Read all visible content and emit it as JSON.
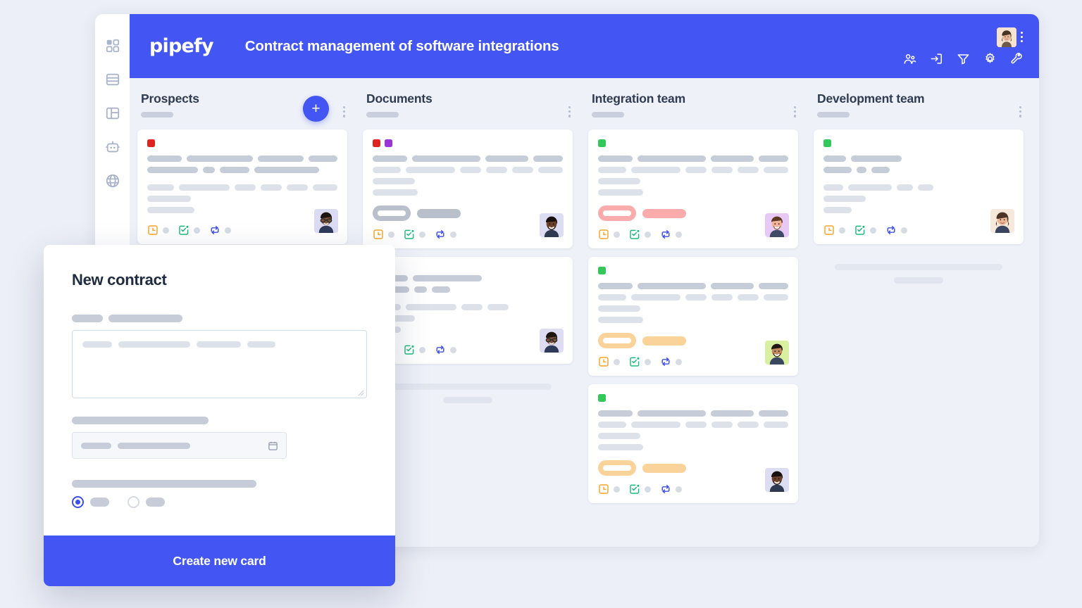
{
  "sidebar": {
    "items": [
      {
        "icon": "apps-grid-icon",
        "name": "sidebar-item-apps"
      },
      {
        "icon": "database-icon",
        "name": "sidebar-item-database"
      },
      {
        "icon": "layout-icon",
        "name": "sidebar-item-layout"
      },
      {
        "icon": "robot-icon",
        "name": "sidebar-item-automation"
      },
      {
        "icon": "globe-icon",
        "name": "sidebar-item-portal"
      }
    ]
  },
  "header": {
    "logo": "pipefy",
    "title": "Contract management of software integrations",
    "tools": [
      {
        "icon": "members-icon",
        "label": "Members"
      },
      {
        "icon": "import-icon",
        "label": "Import"
      },
      {
        "icon": "filter-icon",
        "label": "Filter"
      },
      {
        "icon": "gear-icon",
        "label": "Settings"
      },
      {
        "icon": "wrench-icon",
        "label": "Tools"
      }
    ],
    "avatar": "user-avatar",
    "menu": "header-menu"
  },
  "board": {
    "add_card_label": "+",
    "columns": [
      {
        "title": "Prospects",
        "cards": [
          {
            "tags": [
              "#e0241b"
            ],
            "pill_color": null,
            "avatar": "avatar-card-1",
            "footer_icons": [
              "deadline-icon",
              "checklist-icon",
              "connection-icon"
            ]
          }
        ],
        "ghost": false
      },
      {
        "title": "Documents",
        "cards": [
          {
            "tags": [
              "#e0241b",
              "#9b35d4"
            ],
            "pill_color": "#b9bfcb",
            "avatar": "avatar-card-2",
            "footer_icons": [
              "deadline-icon",
              "checklist-icon",
              "connection-icon"
            ]
          },
          {
            "tags": [],
            "pill_color": null,
            "avatar": "avatar-card-3",
            "footer_icons": [
              "deadline-icon",
              "checklist-icon",
              "connection-icon"
            ]
          }
        ],
        "ghost": true
      },
      {
        "title": "Integration team",
        "cards": [
          {
            "tags": [
              "#34c759"
            ],
            "pill_color": "#f9acab",
            "avatar": "avatar-card-4",
            "footer_icons": [
              "deadline-icon",
              "checklist-icon",
              "connection-icon"
            ]
          },
          {
            "tags": [
              "#34c759"
            ],
            "pill_color": "#fad39a",
            "avatar": "avatar-card-5",
            "footer_icons": [
              "deadline-icon",
              "checklist-icon",
              "connection-icon"
            ]
          },
          {
            "tags": [
              "#34c759"
            ],
            "pill_color": "#fad39a",
            "avatar": "avatar-card-6",
            "footer_icons": [
              "deadline-icon",
              "checklist-icon",
              "connection-icon"
            ]
          }
        ],
        "ghost": false
      },
      {
        "title": "Development team",
        "cards": [
          {
            "tags": [
              "#34c759"
            ],
            "pill_color": null,
            "avatar": "avatar-card-7",
            "footer_icons": [
              "deadline-icon",
              "checklist-icon",
              "connection-icon"
            ]
          }
        ],
        "ghost": true
      }
    ]
  },
  "modal": {
    "title": "New contract",
    "submit_label": "Create new card",
    "date_icon": "calendar-icon",
    "radio_selected_index": 0
  },
  "colors": {
    "brand_blue": "#4355f2",
    "page_bg": "#eceff7",
    "board_bg": "#eef1f8",
    "tag_red": "#e0241b",
    "tag_purple": "#9b35d4",
    "tag_green": "#34c759",
    "pill_pink": "#f9acab",
    "pill_yellow": "#fad39a",
    "pill_gray": "#b9bfcb",
    "icon_orange": "#f5a623",
    "icon_green": "#18bd7d",
    "icon_blue": "#3b4ef0"
  }
}
